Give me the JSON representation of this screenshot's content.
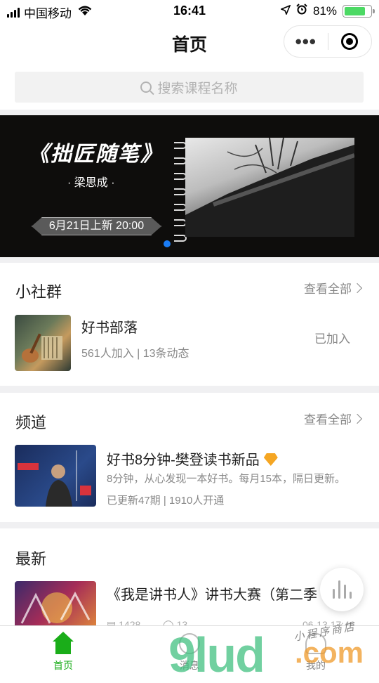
{
  "status_bar": {
    "carrier": "中国移动",
    "time": "16:41",
    "battery": "81%",
    "battery_level": 0.81
  },
  "nav": {
    "title": "首页"
  },
  "search": {
    "placeholder": "搜索课程名称"
  },
  "banner": {
    "title": "《拙匠随笔》",
    "author": "· 梁思成 ·",
    "release": "6月21日上新  20:00"
  },
  "community": {
    "heading": "小社群",
    "see_all": "查看全部",
    "items": [
      {
        "name": "好书部落",
        "meta": "561人加入 | 13条动态",
        "status": "已加入"
      }
    ]
  },
  "channel": {
    "heading": "频道",
    "see_all": "查看全部",
    "items": [
      {
        "name": "好书8分钟-樊登读书新品",
        "desc": "8分钟，从心发现一本好书。每月15本，隔日更新。",
        "meta": "已更新47期 | 1910人开通"
      }
    ]
  },
  "latest": {
    "heading": "最新",
    "items": [
      {
        "name": "《我是讲书人》讲书大赛（第二季",
        "plays": "1428",
        "comments": "13",
        "date": "06-13 17:46"
      }
    ]
  },
  "tabbar": {
    "items": [
      {
        "label": "首页"
      },
      {
        "label": "消息"
      },
      {
        "label": "我的"
      }
    ]
  },
  "watermark": {
    "main": "9lud",
    "suffix": ".com",
    "tag": "小程序商店"
  },
  "colors": {
    "accent": "#1aad19",
    "banner_bg": "#0e0d0c",
    "indicator": "#1a7cf5"
  }
}
